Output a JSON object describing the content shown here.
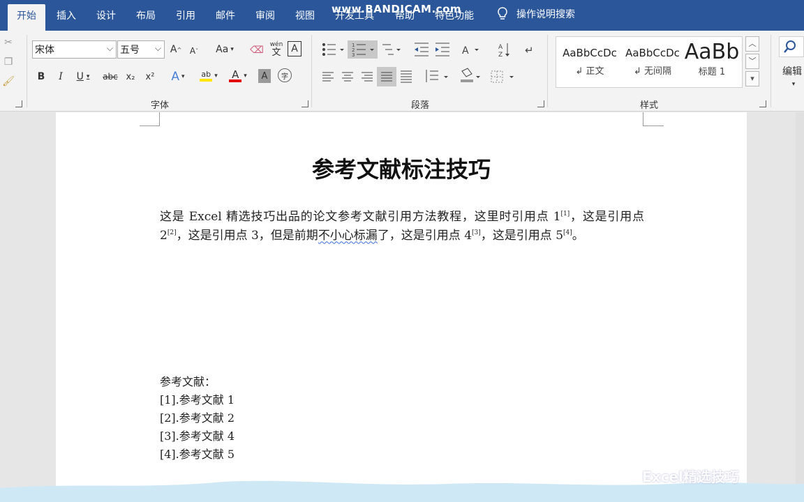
{
  "tabs": [
    "开始",
    "插入",
    "设计",
    "布局",
    "引用",
    "邮件",
    "审阅",
    "视图",
    "开发工具",
    "帮助",
    "特色功能"
  ],
  "watermark": "www.BANDICAM.com",
  "tell_me": "操作说明搜索",
  "font": {
    "name": "宋体",
    "size": "五号",
    "grow": "A",
    "shrink": "A",
    "case": "Aa",
    "phonetic": "wén",
    "phonetic_char": "文",
    "border_char": "A",
    "bold": "B",
    "italic": "I",
    "underline": "U",
    "strike": "abc",
    "sub": "x₂",
    "sup": "x²",
    "effects": "A",
    "highlight": "ab",
    "color": "A",
    "shading": "A",
    "enclose": "字",
    "group_label": "字体"
  },
  "paragraph": {
    "group_label": "段落"
  },
  "styles": {
    "items": [
      {
        "sample": "AaBbCcDc",
        "name": "↲ 正文"
      },
      {
        "sample": "AaBbCcDc",
        "name": "↲ 无间隔"
      },
      {
        "sample": "AaBb",
        "name": "标题 1"
      }
    ],
    "group_label": "样式"
  },
  "edit_label": "编辑",
  "document": {
    "title": "参考文献标注技巧",
    "para_parts": [
      "这是 Excel 精选技巧出品的论文参考文献引用方法教程，这里时引用点 1",
      "[1]",
      "，这是引用点 2",
      "[2]",
      "，这是引用点 3，但是前期",
      "不小心标漏",
      "了，这是引用点 4",
      "[3]",
      "，这是引用点 5",
      "[4]",
      "。"
    ],
    "refs_heading": "参考文献：",
    "refs": [
      "[1].参考文献 1",
      "[2].参考文献 2",
      "[3].参考文献 4",
      "[4].参考文献 5"
    ]
  },
  "corner_logo": "Excel精选技巧"
}
